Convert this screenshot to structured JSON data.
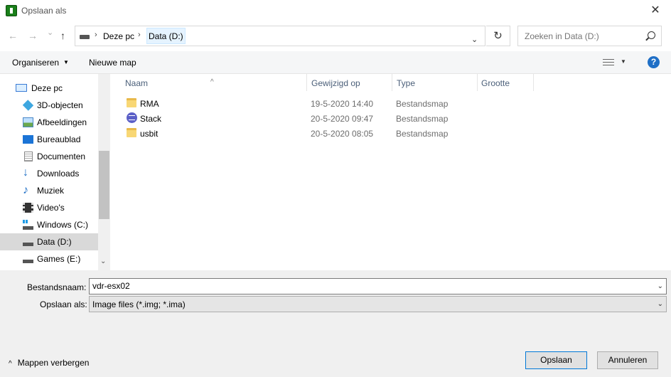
{
  "window": {
    "title": "Opslaan als",
    "close_glyph": "✕"
  },
  "nav": {
    "back_glyph": "←",
    "forward_glyph": "→",
    "recent_glyph": "⌄",
    "up_glyph": "↑"
  },
  "address": {
    "crumbs": [
      "Deze pc",
      "Data (D:)"
    ],
    "separator": "›",
    "dropdown_glyph": "⌄",
    "refresh_glyph": "↻"
  },
  "search": {
    "placeholder": "Zoeken in Data (D:)"
  },
  "toolbar": {
    "organize_label": "Organiseren",
    "organize_caret": "▼",
    "new_folder_label": "Nieuwe map",
    "view_caret": "▼",
    "help_label": "?"
  },
  "sidebar": {
    "items": [
      {
        "label": "Deze pc",
        "icon": "monitor-icon"
      },
      {
        "label": "3D-objecten",
        "icon": "cube-icon"
      },
      {
        "label": "Afbeeldingen",
        "icon": "image-icon"
      },
      {
        "label": "Bureaublad",
        "icon": "desktop-icon"
      },
      {
        "label": "Documenten",
        "icon": "document-icon"
      },
      {
        "label": "Downloads",
        "icon": "download-arrow-icon"
      },
      {
        "label": "Muziek",
        "icon": "music-note-icon"
      },
      {
        "label": "Video's",
        "icon": "film-icon"
      },
      {
        "label": "Windows (C:)",
        "icon": "windows-drive-icon"
      },
      {
        "label": "Data (D:)",
        "icon": "drive-icon"
      },
      {
        "label": "Games (E:)",
        "icon": "drive-icon"
      }
    ],
    "selected_index": 9,
    "scroll_down_glyph": "⌄"
  },
  "columns": {
    "name": "Naam",
    "modified": "Gewijzigd op",
    "type": "Type",
    "size": "Grootte",
    "sort_glyph": "^"
  },
  "files": [
    {
      "name": "RMA",
      "modified": "19-5-2020 14:40",
      "type": "Bestandsmap",
      "icon": "folder-icon"
    },
    {
      "name": "Stack",
      "modified": "20-5-2020 09:47",
      "type": "Bestandsmap",
      "icon": "stack-folder-icon"
    },
    {
      "name": "usbit",
      "modified": "20-5-2020 08:05",
      "type": "Bestandsmap",
      "icon": "folder-icon"
    }
  ],
  "form": {
    "filename_label": "Bestandsnaam:",
    "filename_value": "vdr-esx02",
    "savetype_label": "Opslaan als:",
    "savetype_value": "Image files (*.img; *.ima)",
    "caret_glyph": "⌄"
  },
  "footer": {
    "hide_folders_label": "Mappen verbergen",
    "hide_folders_caret": "^",
    "save_label": "Opslaan",
    "cancel_label": "Annuleren"
  }
}
